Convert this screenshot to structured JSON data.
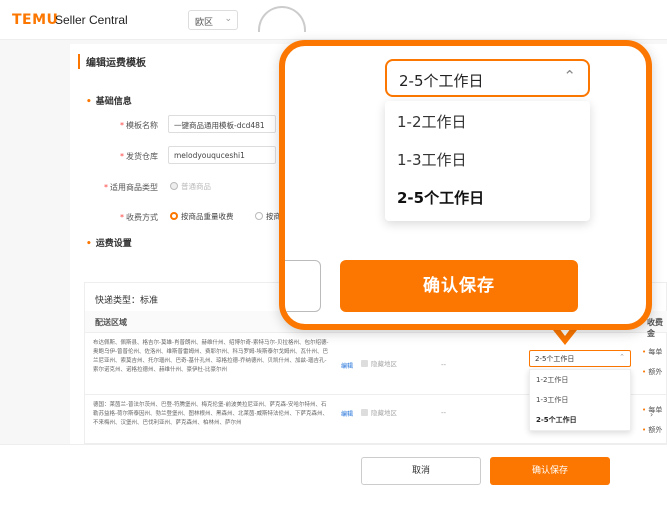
{
  "header": {
    "logo": "TEMU",
    "brand_sub": "Seller Central",
    "region": "欧区",
    "region_chevron": "chevron-down-icon"
  },
  "form": {
    "title": "编辑运费模板",
    "basic_section": "基础信息",
    "template_name_label": "模板名称",
    "template_name_value": "一键商品通用模板-dcd481",
    "warehouse_label": "发货仓库",
    "warehouse_value": "melodyouquceshi1",
    "product_type_label": "适用商品类型",
    "product_type_value": "普通商品",
    "charge_label": "收费方式",
    "charge_option_1": "按商品重量收费",
    "charge_option_2": "按商",
    "fee_section": "运费设置"
  },
  "table": {
    "type_label": "快递类型：标准",
    "col_region": "配送区域",
    "col_fee": "收费金",
    "rows": [
      {
        "regions": "布达佩斯、佩斯县、格吉尔-莫雄-肖普朗州、赫维什州、绍博尔奇-索特马尔-贝拉格州、包尔绍德-奥鲍乌伊-曾普伦州、佐洛州、维斯普雷姆州、费耶尔州、科马罗姆-埃斯泰尔戈姆州、瓦什州、巴兰尼亚州、索莫吉州、托尔瑙州、巴奇-基什孔州、琼格拉德-乔纳德州、贝凯什州、加兹-瑙吉孔-索尔诺克州、诺格拉德州、赫维什州、豪伊杜-比豪尔州",
        "edit": "编辑",
        "check": "隐藏地区",
        "dash": "--",
        "selected": "2-5个工作日",
        "fee_1": "每单",
        "fee_2": "额外"
      },
      {
        "regions": "德国：莱茵兰-普法尔茨州、巴登-符腾堡州、梅克伦堡-前波美拉尼亚州、萨克森-安哈尔特州、石勒苏益格-荷尔斯泰因州、勃兰登堡州、图林根州、黑森州、北莱茵-威斯特法伦州、下萨克森州、不来梅州、汉堡州、巴伐利亚州、萨克森州、柏林州、萨尔州",
        "edit": "编辑",
        "check": "隐藏地区",
        "dash": "--",
        "fee_1": "每单",
        "fee_2": "额外"
      }
    ],
    "dropdown_options": [
      "1-2工作日",
      "1-3工作日",
      "2-5个工作日"
    ]
  },
  "footer": {
    "cancel": "取消",
    "save": "确认保存"
  },
  "zoom": {
    "selected": "2-5个工作日",
    "options": [
      "1-2工作日",
      "1-3工作日",
      "2-5个工作日"
    ],
    "save": "确认保存",
    "chevron": "chevron-up-icon"
  },
  "colors": {
    "accent": "#fb7701",
    "link": "#1e6fd9"
  }
}
